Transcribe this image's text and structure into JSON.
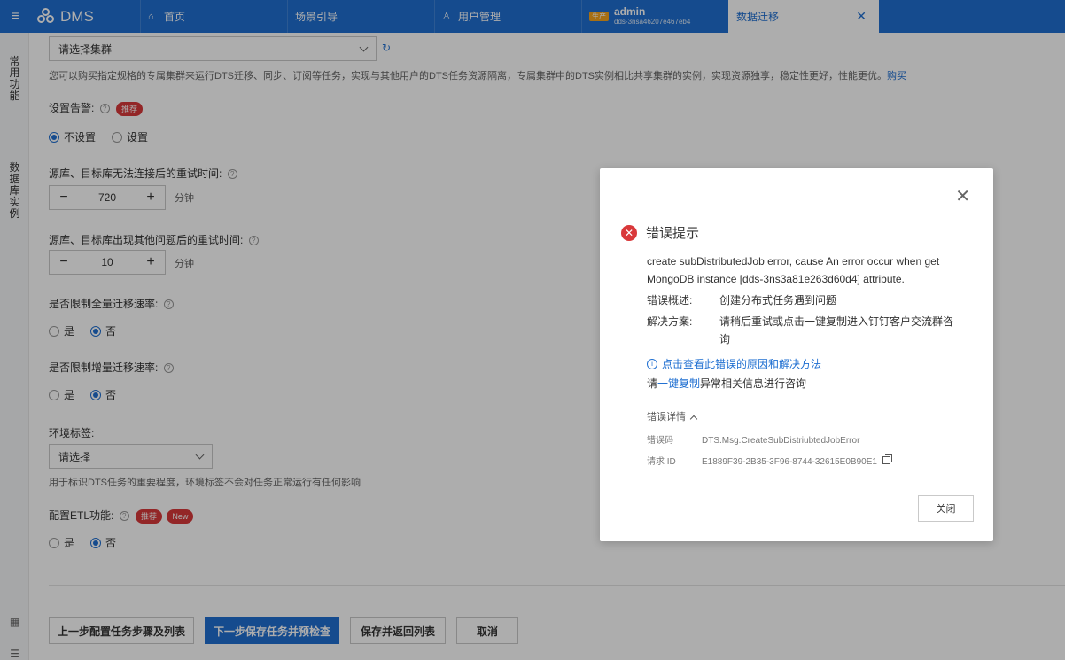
{
  "topbar": {
    "menu_icon": "hamburger-icon",
    "logo_text": "DMS",
    "tabs": [
      {
        "label": "首页",
        "icon": "home-icon"
      },
      {
        "label": "场景引导"
      },
      {
        "label": "用户管理",
        "icon": "user-icon"
      },
      {
        "label": "admin",
        "env": "生产",
        "sub": "dds-3nsa46207e467eb4"
      },
      {
        "label": "数据迁移",
        "active": true
      }
    ]
  },
  "rail": {
    "group1": [
      "常",
      "用",
      "功",
      "能"
    ],
    "group2": [
      "数",
      "据",
      "库",
      "实",
      "例"
    ]
  },
  "form": {
    "cluster_select": "请选择集群",
    "cluster_desc": "您可以购买指定规格的专属集群来运行DTS迁移、同步、订阅等任务，实现与其他用户的DTS任务资源隔离，专属集群中的DTS实例相比共享集群的实例，实现资源独享，稳定性更好，性能更优。",
    "buy_link": "购买",
    "alarm_label": "设置告警:",
    "recommend_badge": "推荐",
    "alarm_options": [
      "不设置",
      "设置"
    ],
    "retry_label": "源库、目标库无法连接后的重试时间:",
    "retry_value": "720",
    "retry_unit": "分钟",
    "other_retry_label": "源库、目标库出现其他问题后的重试时间:",
    "other_retry_value": "10",
    "other_retry_unit": "分钟",
    "full_limit_label": "是否限制全量迁移速率:",
    "incr_limit_label": "是否限制增量迁移速率:",
    "yes_no": [
      "是",
      "否"
    ],
    "env_label": "环境标签:",
    "env_select": "请选择",
    "env_desc": "用于标识DTS任务的重要程度，环境标签不会对任务正常运行有任何影响",
    "etl_label": "配置ETL功能:",
    "new_badge": "New"
  },
  "buttons": {
    "prev": "上一步配置任务步骤及列表",
    "next": "下一步保存任务并预检查",
    "save_return": "保存并返回列表",
    "cancel": "取消"
  },
  "dialog": {
    "title": "错误提示",
    "message": "create subDistributedJob error, cause An error occur when get MongoDB instance [dds-3ns3a81e263d60d4] attribute.",
    "summary_label": "错误概述:",
    "summary_value": "创建分布式任务遇到问题",
    "solution_label": "解决方案:",
    "solution_value": "请稍后重试或点击一键复制进入钉钉客户交流群咨询",
    "help_link": "点击查看此错误的原因和解决方法",
    "copy_prefix": "请",
    "copy_link": "一键复制",
    "copy_suffix": "异常相关信息进行咨询",
    "details_label": "错误详情",
    "code_label": "错误码",
    "code_value": "DTS.Msg.CreateSubDistriubtedJobError",
    "request_label": "请求 ID",
    "request_value": "E1889F39-2B35-3F96-8744-32615E0B90E1",
    "close_button": "关闭"
  }
}
